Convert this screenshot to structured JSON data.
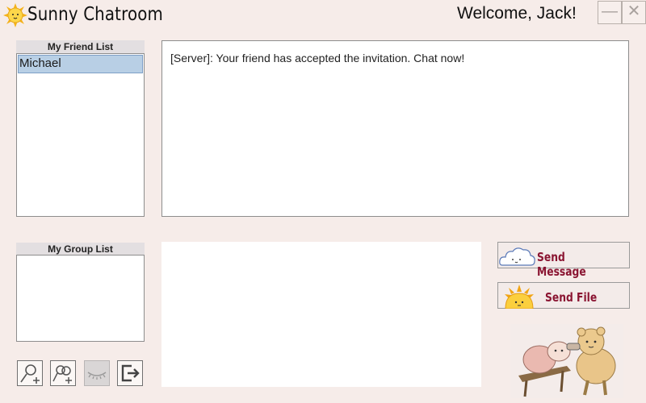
{
  "app": {
    "title": "Sunny Chatroom",
    "welcome": "Welcome, Jack!",
    "minimize_symbol": "—",
    "close_symbol": "✕"
  },
  "friends": {
    "header": "My Friend List",
    "items": [
      "Michael"
    ],
    "selected": "Michael"
  },
  "groups": {
    "header": "My Group List",
    "items": []
  },
  "chat": {
    "messages": [
      "[Server]: Your friend has accepted the invitation. Chat now!"
    ]
  },
  "input": {
    "value": ""
  },
  "actions": {
    "send_message": "Send Message",
    "send_file": "Send File",
    "icons": [
      "add-friend-icon",
      "add-group-icon",
      "hide-eye-icon",
      "logout-icon"
    ]
  },
  "colors": {
    "background": "#f6ece9",
    "selection": "#b8cfe5",
    "button_text": "#8a1431"
  }
}
